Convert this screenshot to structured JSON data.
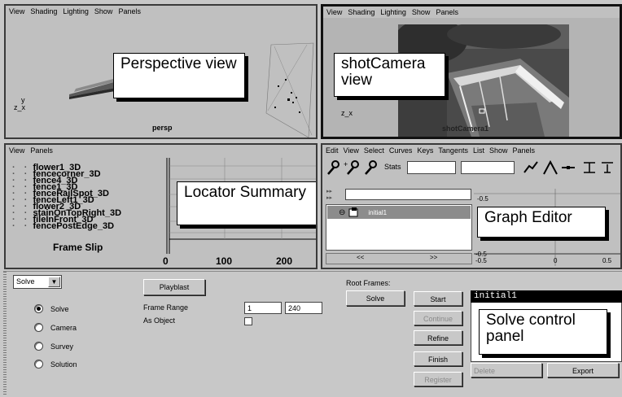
{
  "persp": {
    "menu": [
      "View",
      "Shading",
      "Lighting",
      "Show",
      "Panels"
    ],
    "camera_label": "persp",
    "axis_y": "y",
    "axis_zx": "z_x",
    "callout": "Perspective view"
  },
  "shotcam": {
    "menu": [
      "View",
      "Shading",
      "Lighting",
      "Show",
      "Panels"
    ],
    "camera_label": "shotCamera1",
    "axis_zx": "z_x",
    "callout": "shotCamera view"
  },
  "locator": {
    "menu": [
      "View",
      "Panels"
    ],
    "items": [
      "flower1_3D",
      "fencecorner_3D",
      "fence4_3D",
      "fence1_3D",
      "fenceRailSpot_3D",
      "fenceLeft1_3D",
      "flower2_3D",
      "stainOnTopRight_3D",
      "fileInFront_3D",
      "fencePostEdge_3D"
    ],
    "frame_slip": "Frame Slip",
    "ticks": [
      "0",
      "100",
      "200"
    ],
    "callout": "Locator Summary"
  },
  "graph": {
    "menu": [
      "Edit",
      "View",
      "Select",
      "Curves",
      "Keys",
      "Tangents",
      "List",
      "Show",
      "Panels"
    ],
    "stats_label": "Stats",
    "outliner_item": "initial1",
    "val_top": "-0.5",
    "nav_prev": "<<",
    "nav_next": ">>",
    "axis_labels": [
      "-0.5",
      "-0.5",
      "0",
      "0.5"
    ],
    "callout": "Graph Editor"
  },
  "solve": {
    "mode_select": "Solve",
    "radios": [
      {
        "label": "Solve",
        "checked": true
      },
      {
        "label": "Camera",
        "checked": false
      },
      {
        "label": "Survey",
        "checked": false
      },
      {
        "label": "Solution",
        "checked": false
      }
    ],
    "playblast": "Playblast",
    "frame_range_label": "Frame Range",
    "frame_start": "1",
    "frame_end": "240",
    "as_object_label": "As Object",
    "root_frames_label": "Root Frames:",
    "root_solve_button": "Solve",
    "start": "Start",
    "continue": "Continue",
    "refine": "Refine",
    "finish": "Finish",
    "register": "Register",
    "solution_header": "initial1",
    "delete": "Delete",
    "export": "Export",
    "callout": "Solve control panel"
  }
}
